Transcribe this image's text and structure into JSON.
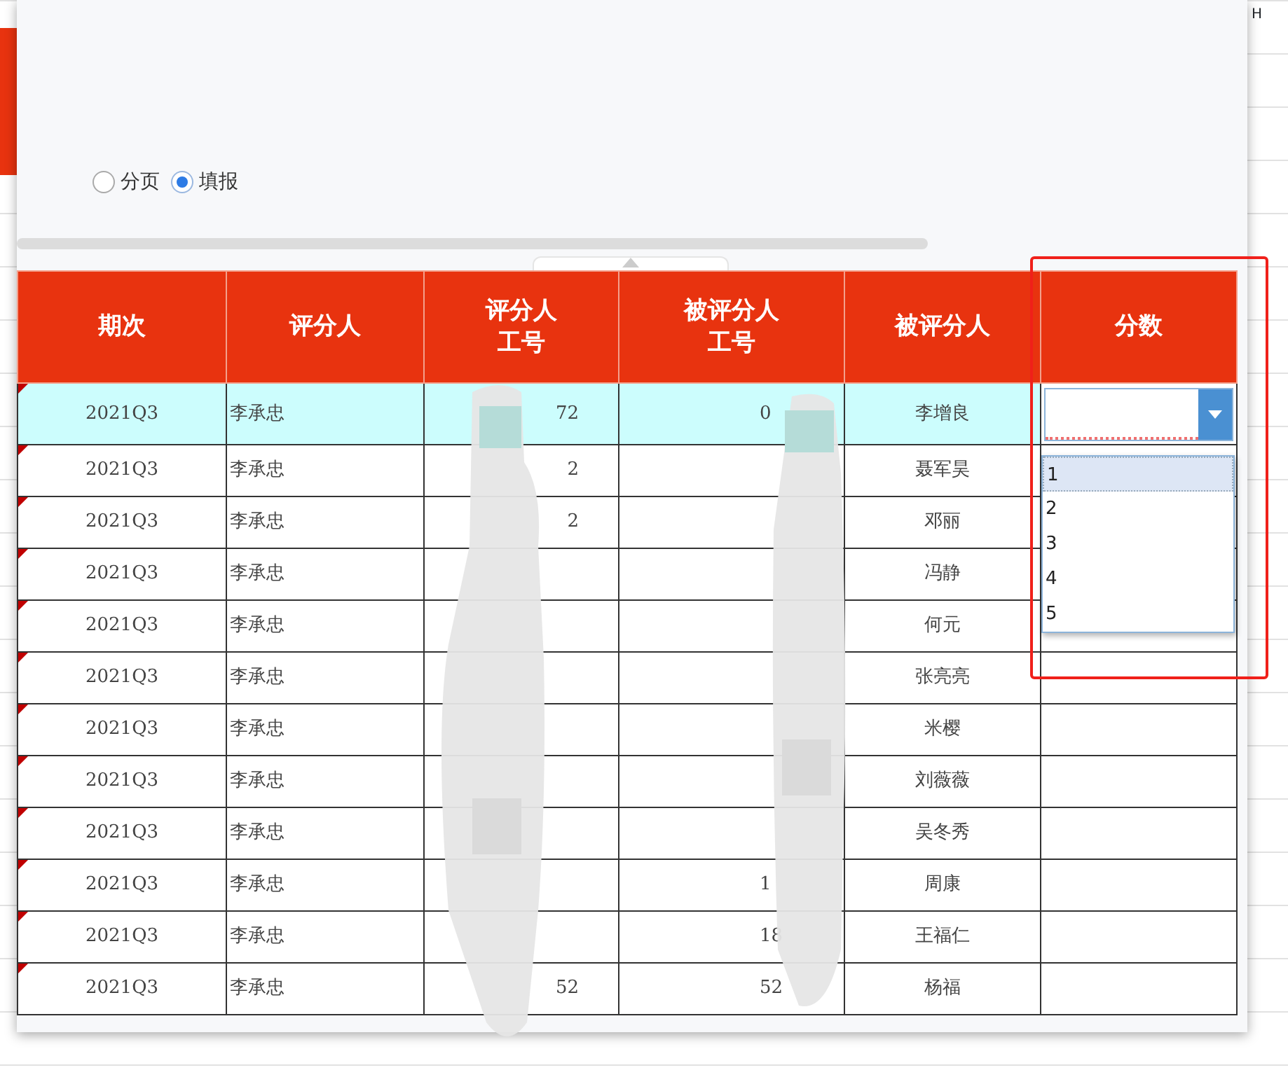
{
  "spreadsheet": {
    "column_label": "H"
  },
  "view_mode": [
    {
      "label": "分页",
      "selected": false
    },
    {
      "label": "填报",
      "selected": true
    }
  ],
  "table": {
    "columns": [
      [
        "期次"
      ],
      [
        "评分人"
      ],
      [
        "评分人",
        "工号"
      ],
      [
        "被评分人",
        "工号"
      ],
      [
        "被评分人"
      ],
      [
        "分数"
      ]
    ],
    "rows": [
      {
        "period": "2021Q3",
        "rater": "李承忠",
        "rater_id": "72",
        "ratee_id": "0",
        "ratee": "李增良",
        "selected": true,
        "comment_mark": true
      },
      {
        "period": "2021Q3",
        "rater": "李承忠",
        "rater_id": "2",
        "ratee": "聂军昊",
        "selected": false,
        "comment_mark": true
      },
      {
        "period": "2021Q3",
        "rater": "李承忠",
        "rater_id": "2",
        "ratee": "邓丽",
        "selected": false,
        "comment_mark": true
      },
      {
        "period": "2021Q3",
        "rater": "李承忠",
        "ratee": "冯静",
        "selected": false,
        "comment_mark": true
      },
      {
        "period": "2021Q3",
        "rater": "李承忠",
        "ratee": "何元",
        "selected": false,
        "comment_mark": true
      },
      {
        "period": "2021Q3",
        "rater": "李承忠",
        "ratee": "张亮亮",
        "selected": false,
        "comment_mark": true
      },
      {
        "period": "2021Q3",
        "rater": "李承忠",
        "ratee": "米樱",
        "selected": false,
        "comment_mark": true
      },
      {
        "period": "2021Q3",
        "rater": "李承忠",
        "ratee": "刘薇薇",
        "selected": false,
        "comment_mark": true
      },
      {
        "period": "2021Q3",
        "rater": "李承忠",
        "ratee": "吴冬秀",
        "selected": false,
        "comment_mark": true
      },
      {
        "period": "2021Q3",
        "rater": "李承忠",
        "ratee_id": "1",
        "ratee": "周康",
        "selected": false,
        "comment_mark": true
      },
      {
        "period": "2021Q3",
        "rater": "李承忠",
        "ratee_id": "18",
        "ratee": "王福仁",
        "selected": false,
        "comment_mark": true
      },
      {
        "period": "2021Q3",
        "rater": "李承忠",
        "rater_id": "52",
        "ratee_id": "52",
        "ratee": "杨福",
        "selected": false,
        "comment_mark": true
      }
    ]
  },
  "score_dropdown": {
    "open": true,
    "options": [
      {
        "label": "1",
        "selected": true
      },
      {
        "label": "2",
        "selected": false
      },
      {
        "label": "3",
        "selected": false
      },
      {
        "label": "4",
        "selected": false
      },
      {
        "label": "5",
        "selected": false
      }
    ]
  }
}
